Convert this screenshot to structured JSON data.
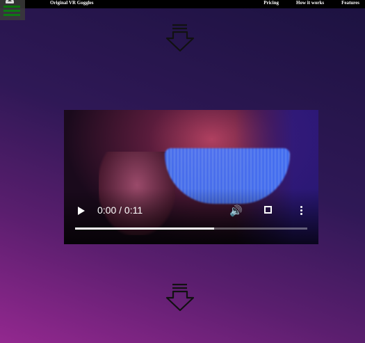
{
  "header": {
    "brand": "Original VR Goggles",
    "nav": [
      "Pricing",
      "How it works",
      "Features"
    ]
  },
  "icons": {
    "menu": "hamburger-menu-icon",
    "lock": "lock-icon",
    "arrow": "down-arrow-icon"
  },
  "video": {
    "time_label": "0:00 / 0:11",
    "progress": 0.6
  },
  "colors": {
    "menu_bars": "#0a8a0a",
    "topbar": "#000000"
  }
}
